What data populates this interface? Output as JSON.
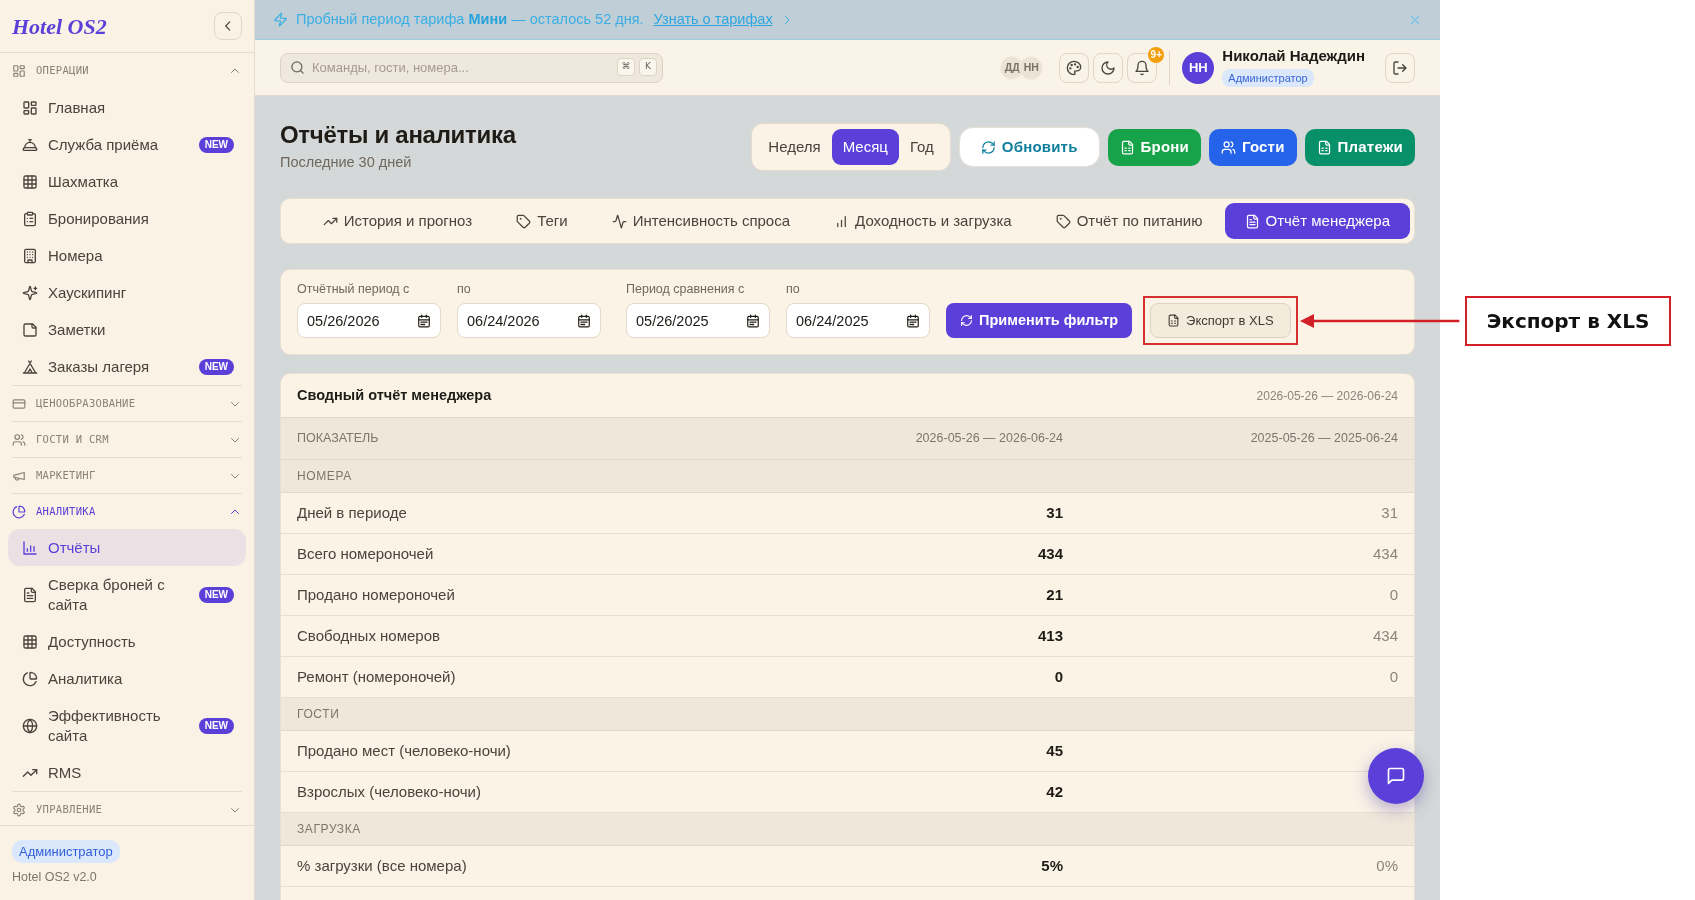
{
  "sidebar": {
    "logo": "Hotel OS2",
    "groups": [
      {
        "label": "ОПЕРАЦИИ",
        "expanded": true,
        "items": [
          {
            "label": "Главная",
            "selected": false
          },
          {
            "label": "Служба приёма",
            "selected": false,
            "badge": "NEW"
          },
          {
            "label": "Шахматка",
            "selected": false
          },
          {
            "label": "Бронирования",
            "selected": false
          },
          {
            "label": "Номера",
            "selected": false
          },
          {
            "label": "Хаускипинг",
            "selected": false
          },
          {
            "label": "Заметки",
            "selected": false
          },
          {
            "label": "Заказы лагеря",
            "selected": false,
            "badge": "NEW"
          }
        ]
      },
      {
        "label": "ЦЕНООБРАЗОВАНИЕ",
        "expanded": false
      },
      {
        "label": "ГОСТИ И CRM",
        "expanded": false
      },
      {
        "label": "МАРКЕТИНГ",
        "expanded": false
      },
      {
        "label": "АНАЛИТИКА",
        "expanded": true,
        "items": [
          {
            "label": "Отчёты",
            "selected": true
          },
          {
            "label": "Сверка броней с сайта",
            "selected": false,
            "badge": "NEW"
          },
          {
            "label": "Доступность",
            "selected": false
          },
          {
            "label": "Аналитика",
            "selected": false
          },
          {
            "label": "Эффективность сайта",
            "selected": false,
            "badge": "NEW"
          },
          {
            "label": "RMS",
            "selected": false
          }
        ]
      },
      {
        "label": "УПРАВЛЕНИЕ",
        "expanded": false
      }
    ],
    "role_badge": "Администратор",
    "version": "Hotel OS2 v2.0"
  },
  "banner": {
    "text": "Пробный период тарифа **Мини** — осталось 52 дня.",
    "link": "Узнать о тарифах"
  },
  "topbar": {
    "search": {
      "placeholder": "Команды, гости, номера..."
    },
    "shortcut_keys": [
      "⌘",
      "K"
    ],
    "presence": [
      "ДД",
      "НН"
    ],
    "notifications_badge": "9+",
    "user": {
      "initials": "НН",
      "name": "Николай Надеждин",
      "role": "Администратор"
    }
  },
  "page": {
    "title": "Отчёты и аналитика",
    "subtitle": "Последние 30 дней",
    "periods": [
      {
        "label": "Неделя",
        "selected": false
      },
      {
        "label": "Месяц",
        "selected": true
      },
      {
        "label": "Год",
        "selected": false
      }
    ],
    "actions": [
      {
        "label": "Обновить",
        "kind": "refresh"
      },
      {
        "label": "Брони",
        "kind": "bookings"
      },
      {
        "label": "Гости",
        "kind": "guests"
      },
      {
        "label": "Платежи",
        "kind": "payments"
      }
    ]
  },
  "report_tabs": [
    {
      "label": "История и прогноз",
      "selected": false
    },
    {
      "label": "Теги",
      "selected": false
    },
    {
      "label": "Интенсивность спроса",
      "selected": false
    },
    {
      "label": "Доходность и загрузка",
      "selected": false
    },
    {
      "label": "Отчёт по питанию",
      "selected": false
    },
    {
      "label": "Отчёт менеджера",
      "selected": true
    }
  ],
  "filters": {
    "fields": [
      {
        "label": "Отчётный период с",
        "value": "05/26/2026"
      },
      {
        "label": "по",
        "value": "06/24/2026"
      },
      {
        "label": "Период сравнения с",
        "value": "05/26/2025"
      },
      {
        "label": "по",
        "value": "06/24/2025"
      }
    ],
    "apply_button": "Применить фильтр",
    "export_button": "Экспорт в XLS"
  },
  "report": {
    "title": "Сводный отчёт менеджера",
    "range": "2026-05-26 — 2026-06-24",
    "columns": [
      "ПОКАЗАТЕЛЬ",
      "2026-05-26 — 2026-06-24",
      "2025-05-26 — 2025-06-24"
    ],
    "rows": [
      {
        "kind": "section",
        "label": "НОМЕРА"
      },
      {
        "kind": "metric",
        "label": "Дней в периоде",
        "current": "31",
        "previous": "31"
      },
      {
        "kind": "metric",
        "label": "Всего номероночей",
        "current": "434",
        "previous": "434"
      },
      {
        "kind": "metric",
        "label": "Продано номероночей",
        "current": "21",
        "previous": "0"
      },
      {
        "kind": "metric",
        "label": "Свободных номеров",
        "current": "413",
        "previous": "434"
      },
      {
        "kind": "metric",
        "label": "Ремонт (номероночей)",
        "current": "0",
        "previous": "0"
      },
      {
        "kind": "section",
        "label": "ГОСТИ"
      },
      {
        "kind": "metric",
        "label": "Продано мест (человеко-ночи)",
        "current": "45"
      },
      {
        "kind": "metric",
        "label": "Взрослых (человеко-ночи)",
        "current": "42"
      },
      {
        "kind": "section",
        "label": "ЗАГРУЗКА"
      },
      {
        "kind": "metric",
        "label": "% загрузки (все номера)",
        "current": "5%",
        "previous": "0%"
      }
    ]
  },
  "annotation": {
    "label": "Экспорт в XLS"
  }
}
